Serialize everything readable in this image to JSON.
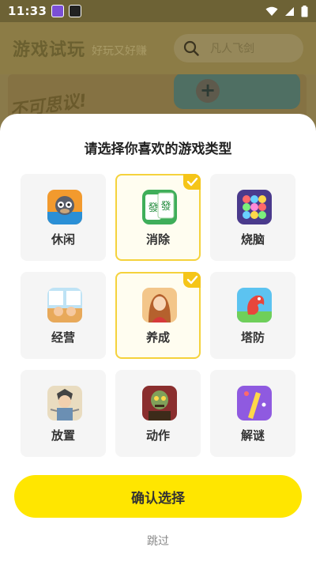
{
  "status_bar": {
    "time": "11:33",
    "icons": [
      "app-notification-icon",
      "app-notification-icon",
      "wifi-icon",
      "signal-icon",
      "battery-icon"
    ]
  },
  "background": {
    "title": "游戏试玩",
    "subtitle": "好玩又好赚",
    "search_placeholder": "凡人飞剑",
    "banner_text": "不可思议!"
  },
  "sheet": {
    "title": "请选择你喜欢的游戏类型",
    "categories": [
      {
        "label": "休闲",
        "icon": "monkey-game-icon",
        "selected": false
      },
      {
        "label": "消除",
        "icon": "mahjong-tile-icon",
        "selected": true
      },
      {
        "label": "烧脑",
        "icon": "color-balls-icon",
        "selected": false
      },
      {
        "label": "经营",
        "icon": "business-game-icon",
        "selected": false
      },
      {
        "label": "养成",
        "icon": "character-girl-icon",
        "selected": true
      },
      {
        "label": "塔防",
        "icon": "dragon-tower-icon",
        "selected": false
      },
      {
        "label": "放置",
        "icon": "idle-hero-icon",
        "selected": false
      },
      {
        "label": "动作",
        "icon": "zombie-action-icon",
        "selected": false
      },
      {
        "label": "解谜",
        "icon": "puzzle-bottle-icon",
        "selected": false
      }
    ],
    "confirm_label": "确认选择",
    "skip_label": "跳过"
  },
  "colors": {
    "accent": "#ffe600",
    "selected_border": "#f5d23c",
    "check_badge": "#f5c518"
  }
}
